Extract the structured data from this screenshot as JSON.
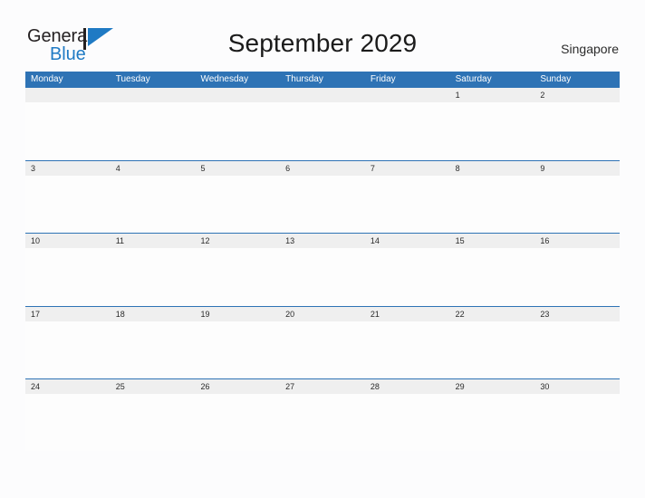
{
  "branding": {
    "logo_text_primary": "General",
    "logo_text_secondary": "Blue",
    "logo_flag_icon": "flag-triangle-icon",
    "primary_color": "#2e73b5",
    "logo_blue_color": "#1f7ac4"
  },
  "header": {
    "title": "September 2029",
    "location": "Singapore"
  },
  "calendar": {
    "weekdays": [
      "Monday",
      "Tuesday",
      "Wednesday",
      "Thursday",
      "Friday",
      "Saturday",
      "Sunday"
    ],
    "band_color": "#efefef",
    "header_color": "#2e73b5",
    "weeks": [
      {
        "days": [
          "",
          "",
          "",
          "",
          "",
          "1",
          "2"
        ]
      },
      {
        "days": [
          "3",
          "4",
          "5",
          "6",
          "7",
          "8",
          "9"
        ]
      },
      {
        "days": [
          "10",
          "11",
          "12",
          "13",
          "14",
          "15",
          "16"
        ]
      },
      {
        "days": [
          "17",
          "18",
          "19",
          "20",
          "21",
          "22",
          "23"
        ]
      },
      {
        "days": [
          "24",
          "25",
          "26",
          "27",
          "28",
          "29",
          "30"
        ]
      }
    ]
  }
}
